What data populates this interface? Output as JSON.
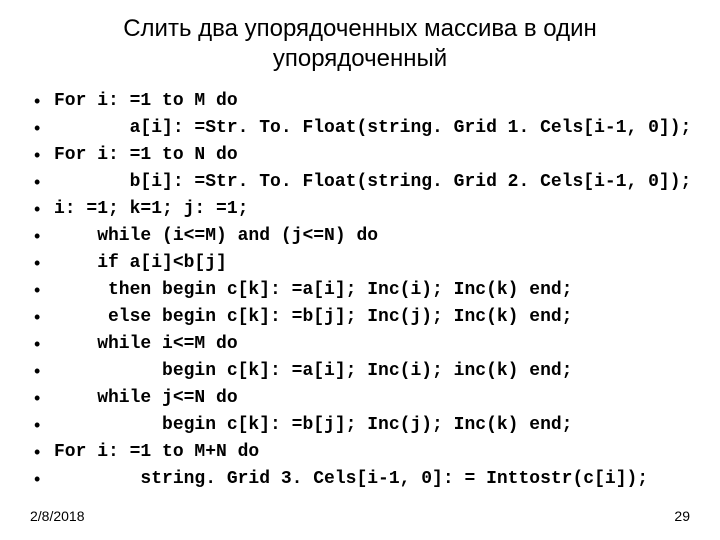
{
  "title_line1": "Слить два упорядоченных массива в один",
  "title_line2": "упорядоченный",
  "bullet": "•",
  "lines": [
    "For i: =1 to M do",
    "       a[i]: =Str. To. Float(string. Grid 1. Cels[i-1, 0]);",
    "For i: =1 to N do",
    "       b[i]: =Str. To. Float(string. Grid 2. Cels[i-1, 0]);",
    "i: =1; k=1; j: =1;",
    "    while (i<=M) and (j<=N) do",
    "    if a[i]<b[j]",
    "     then begin c[k]: =a[i]; Inc(i); Inc(k) end;",
    "     else begin c[k]: =b[j]; Inc(j); Inc(k) end;",
    "    while i<=M do",
    "          begin c[k]: =a[i]; Inc(i); inc(k) end;",
    "    while j<=N do",
    "          begin c[k]: =b[j]; Inc(j); Inc(k) end;",
    "For i: =1 to M+N do",
    "        string. Grid 3. Cels[i-1, 0]: = Inttostr(c[i]);"
  ],
  "footer_date": "2/8/2018",
  "footer_page": "29"
}
